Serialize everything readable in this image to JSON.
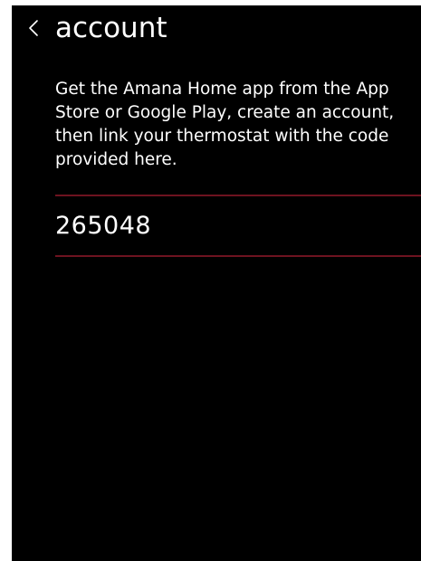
{
  "header": {
    "back_icon": "chevron-left-icon",
    "title": "account"
  },
  "content": {
    "instructions": "Get the Amana Home app from the App Store or Google Play, create an account, then link your thermostat with the code provided here.",
    "link_code": "265048"
  },
  "colors": {
    "background": "#000000",
    "text": "#ffffff",
    "divider": "#6e1320"
  }
}
